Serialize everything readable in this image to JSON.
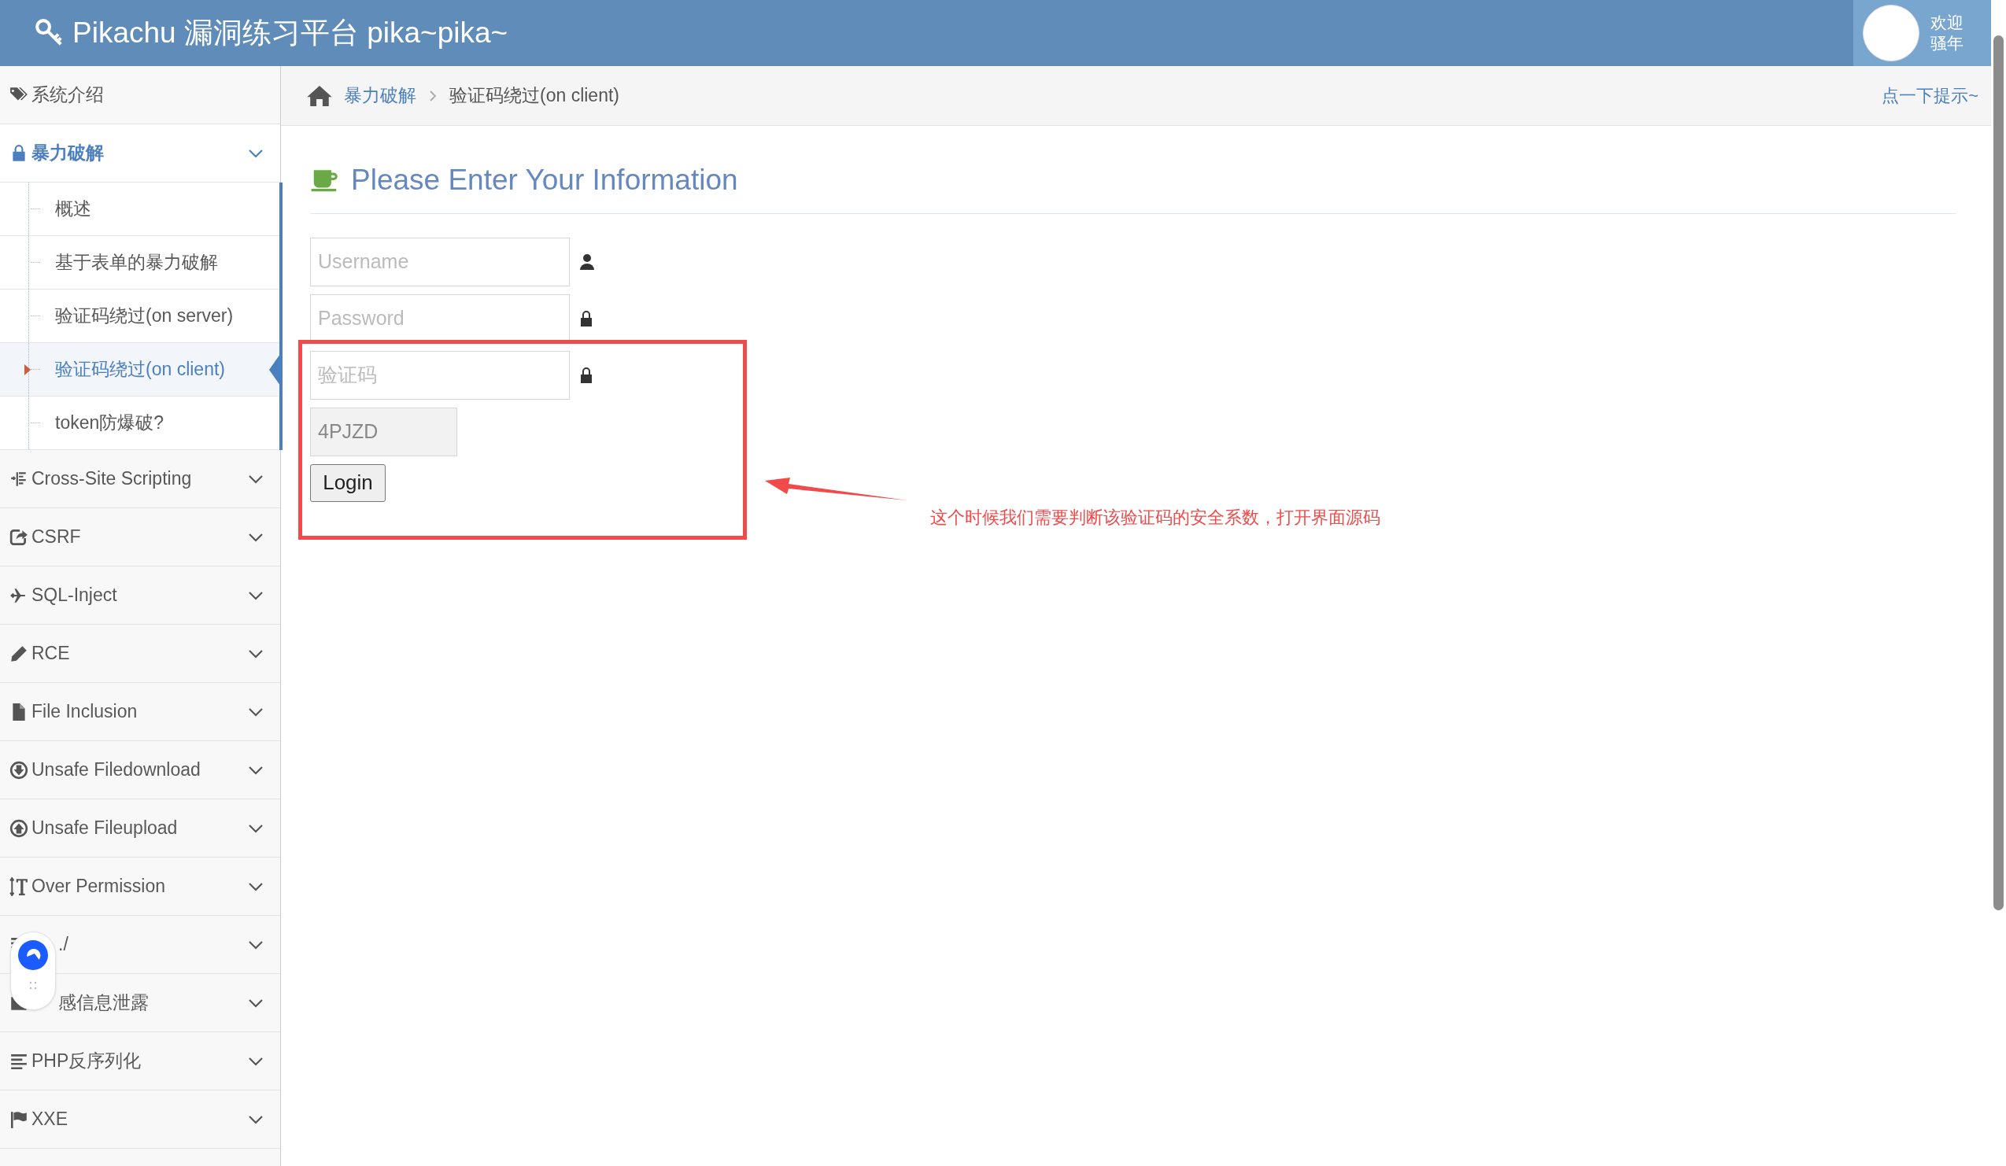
{
  "header": {
    "title": "Pikachu 漏洞练习平台 pika~pika~",
    "welcome": [
      "欢迎",
      "骚年"
    ]
  },
  "sidebar": {
    "items": [
      {
        "label": "系统介绍",
        "expanded": false,
        "has_chevron": false
      },
      {
        "label": "暴力破解",
        "expanded": true,
        "has_chevron": true,
        "children": [
          {
            "label": "概述",
            "selected": false
          },
          {
            "label": "基于表单的暴力破解",
            "selected": false
          },
          {
            "label": "验证码绕过(on server)",
            "selected": false
          },
          {
            "label": "验证码绕过(on client)",
            "selected": true
          },
          {
            "label": "token防爆破?",
            "selected": false
          }
        ]
      },
      {
        "label": "Cross-Site Scripting",
        "expanded": false,
        "has_chevron": true
      },
      {
        "label": "CSRF",
        "expanded": false,
        "has_chevron": true
      },
      {
        "label": "SQL-Inject",
        "expanded": false,
        "has_chevron": true
      },
      {
        "label": "RCE",
        "expanded": false,
        "has_chevron": true
      },
      {
        "label": "File Inclusion",
        "expanded": false,
        "has_chevron": true
      },
      {
        "label": "Unsafe Filedownload",
        "expanded": false,
        "has_chevron": true
      },
      {
        "label": "Unsafe Fileupload",
        "expanded": false,
        "has_chevron": true
      },
      {
        "label": "Over Permission",
        "expanded": false,
        "has_chevron": true
      },
      {
        "label": "./",
        "expanded": false,
        "has_chevron": true
      },
      {
        "label": "感信息泄露",
        "expanded": false,
        "has_chevron": true
      },
      {
        "label": "PHP反序列化",
        "expanded": false,
        "has_chevron": true
      },
      {
        "label": "XXE",
        "expanded": false,
        "has_chevron": true
      }
    ]
  },
  "breadcrumb": {
    "items": [
      "暴力破解",
      "验证码绕过(on client)"
    ],
    "hint": "点一下提示~"
  },
  "form": {
    "heading": "Please Enter Your Information",
    "fields": [
      {
        "placeholder": "Username"
      },
      {
        "placeholder": "Password"
      },
      {
        "placeholder": "验证码"
      }
    ],
    "captcha": "4PJZD",
    "button": "Login"
  },
  "annotation": {
    "text": "这个时候我们需要判断该验证码的安全系数，打开界面源码"
  }
}
